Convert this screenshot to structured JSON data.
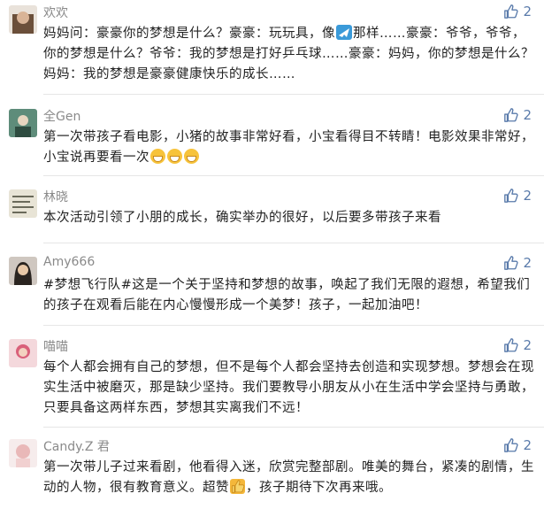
{
  "comments": [
    {
      "name": "欢欢",
      "likes": "2",
      "text": "妈妈问：豪豪你的梦想是什么？豪豪：玩玩具，像",
      "text_b": "那样……豪豪：爷爷，爷爷，你的梦想是什么？爷爷：我的梦想是打好乒乓球……豪豪：妈妈，你的梦想是什么？妈妈：我的梦想是豪豪健康快乐的成长……",
      "avatar_color": "#6b4f3a",
      "icon": "airplane-icon"
    },
    {
      "name": "全Gen",
      "likes": "2",
      "text": "第一次带孩子看电影，小猪的故事非常好看，小宝看得目不转睛！电影效果非常好，小宝说再要看一次",
      "avatar_color": "#4a7a6a",
      "icon": "grin-emoji-icon"
    },
    {
      "name": "林晓",
      "likes": "2",
      "text": "本次活动引领了小朋的成长，确实举办的很好，以后要多带孩子来看",
      "avatar_color": "#b9b4a2"
    },
    {
      "name": "Amy666",
      "likes": "2",
      "text": "#梦想飞行队#这是一个关于坚持和梦想的故事，唤起了我们无限的遐想，希望我们的孩子在观看后能在内心慢慢形成一个美梦！孩子，一起加油吧！",
      "avatar_color": "#3a3a3a"
    },
    {
      "name": "喵喵",
      "likes": "2",
      "text": "每个人都会拥有自己的梦想，但不是每个人都会坚持去创造和实现梦想。梦想会在现实生活中被磨灭，那是缺少坚持。我们要教导小朋友从小在生活中学会坚持与勇敢，只要具备这两样东西，梦想其实离我们不远！",
      "avatar_color": "#d9607a"
    },
    {
      "name": "Candy.Z 君",
      "likes": "2",
      "text": "第一次带儿子过来看剧，他看得入迷，欣赏完整部剧。唯美的舞台，紧凑的剧情，生动的人物，很有教育意义。超赞",
      "text_b": "，孩子期待下次再来哦。",
      "avatar_color": "#e9b8b8",
      "icon": "thumbs-up-emoji-icon"
    }
  ],
  "colors": {
    "like": "#5a7bab",
    "name": "#8a8a8a",
    "text": "#222222"
  }
}
